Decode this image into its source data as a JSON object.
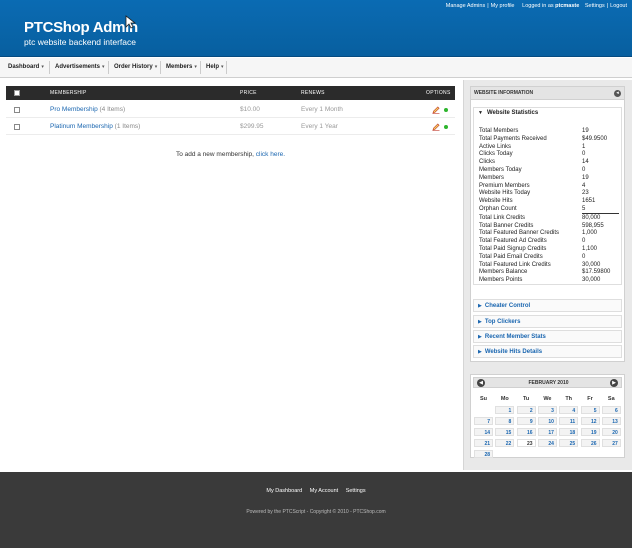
{
  "header": {
    "title": "PTCShop Admin",
    "subtitle": "ptc website backend interface",
    "links": {
      "manage_admins": "Manage Admins",
      "my_profile": "My profile",
      "logged_in_prefix": "Logged in as",
      "username": "ptcmaste",
      "settings": "Settings",
      "logout": "Logout"
    }
  },
  "nav": {
    "items": [
      {
        "label": "Dashboard"
      },
      {
        "label": "Advertisements"
      },
      {
        "label": "Order History"
      },
      {
        "label": "Members"
      },
      {
        "label": "Help"
      }
    ]
  },
  "table": {
    "columns": {
      "membership": "MEMBERSHIP",
      "price": "PRICE",
      "renews": "RENEWS",
      "options": "OPTIONS"
    },
    "rows": [
      {
        "name": "Pro Membership",
        "count": "(4 Items)",
        "price": "$10.00",
        "renews": "Every 1 Month"
      },
      {
        "name": "Platinum Membership",
        "count": "(1 Items)",
        "price": "$299.95",
        "renews": "Every 1 Year"
      }
    ],
    "add_note": {
      "text": "To add a new membership,",
      "link": "click here."
    }
  },
  "sidebar": {
    "title": "WEBSITE INFORMATION",
    "stats_title": "Website Statistics",
    "stats": [
      {
        "label": "Total Members",
        "value": "19"
      },
      {
        "label": "Total Payments Received",
        "value": "$49.9500"
      },
      {
        "label": "Active Links",
        "value": "1"
      },
      {
        "label": "Clicks Today",
        "value": "0"
      },
      {
        "label": "Clicks",
        "value": "14"
      },
      {
        "label": "Members Today",
        "value": "0"
      },
      {
        "label": "Members",
        "value": "19"
      },
      {
        "label": "Premium Members",
        "value": "4"
      },
      {
        "label": "Website Hits Today",
        "value": "23"
      },
      {
        "label": "Website Hits",
        "value": "1651"
      },
      {
        "label": "Orphan Count",
        "value": "5"
      },
      {
        "label": "Total Link Credits",
        "value": "80,000"
      },
      {
        "label": "Total Banner Credits",
        "value": "598,955"
      },
      {
        "label": "Total Featured Banner Credits",
        "value": "1,000"
      },
      {
        "label": "Total Featured Ad Credits",
        "value": "0"
      },
      {
        "label": "Total Paid Signup Credits",
        "value": "1,100"
      },
      {
        "label": "Total Paid Email Credits",
        "value": "0"
      },
      {
        "label": "Total Featured Link Credits",
        "value": "30,000"
      },
      {
        "label": "Members Balance",
        "value": "$17.59800"
      },
      {
        "label": "Members Points",
        "value": "30,000"
      }
    ],
    "sections": [
      {
        "label": "Cheater Control"
      },
      {
        "label": "Top Clickers"
      },
      {
        "label": "Recent Member Stats"
      },
      {
        "label": "Website Hits Details"
      }
    ]
  },
  "calendar": {
    "month": "FEBRUARY 2010",
    "weekdays": [
      "Su",
      "Mo",
      "Tu",
      "We",
      "Th",
      "Fr",
      "Sa"
    ],
    "first_weekday": 1,
    "days_in_month": 28,
    "today": 23
  },
  "footer": {
    "links": [
      "My Dashboard",
      "My Account",
      "Settings"
    ],
    "copyright": "Powered by the PTCScript - Copyright © 2010 - PTCShop.com"
  },
  "colors": {
    "header_blue": "#0a6bb3",
    "link_blue": "#1a66b0",
    "status_green": "#2db52d",
    "footer_dark": "#3a3a3a"
  }
}
